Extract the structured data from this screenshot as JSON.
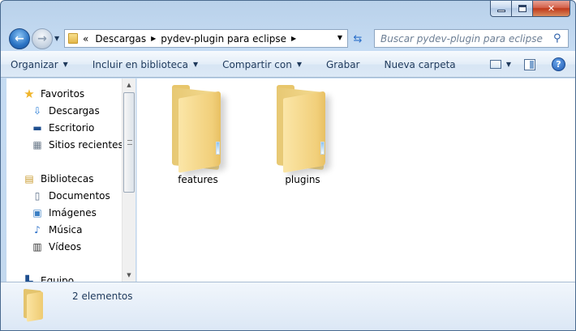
{
  "window": {
    "caption_buttons": {
      "minimize": "minimize-icon",
      "maximize": "maximize-icon",
      "close": "✕"
    }
  },
  "nav": {
    "back_glyph": "←",
    "forward_glyph": "→",
    "breadcrumb": {
      "overflow": "«",
      "items": [
        "Descargas",
        "pydev-plugin para eclipse"
      ]
    },
    "refresh_glyph": "⇆",
    "search": {
      "placeholder": "Buscar pydev-plugin para eclipse"
    }
  },
  "toolbar": {
    "organizar": "Organizar",
    "incluir": "Incluir en biblioteca",
    "compartir": "Compartir con",
    "grabar": "Grabar",
    "nueva_carpeta": "Nueva carpeta",
    "help": "?"
  },
  "sidebar": {
    "groups": [
      {
        "label": "Favoritos",
        "icon": "star-icon"
      },
      {
        "label": "Bibliotecas",
        "icon": "library-icon"
      },
      {
        "label": "Equipo",
        "icon": "computer-icon"
      }
    ],
    "items": [
      {
        "label": "Descargas",
        "icon": "downloads-icon"
      },
      {
        "label": "Escritorio",
        "icon": "desktop-icon"
      },
      {
        "label": "Sitios recientes",
        "icon": "recent-places-icon"
      },
      {
        "label": "Documentos",
        "icon": "documents-icon"
      },
      {
        "label": "Imágenes",
        "icon": "pictures-icon"
      },
      {
        "label": "Música",
        "icon": "music-icon"
      },
      {
        "label": "Vídeos",
        "icon": "videos-icon"
      }
    ]
  },
  "content": {
    "folders": [
      {
        "name": "features"
      },
      {
        "name": "plugins"
      }
    ]
  },
  "details": {
    "count": "2 elementos"
  },
  "colors": {
    "accent": "#1e395b",
    "folder": "#f1cf7a",
    "close": "#c0391b"
  }
}
